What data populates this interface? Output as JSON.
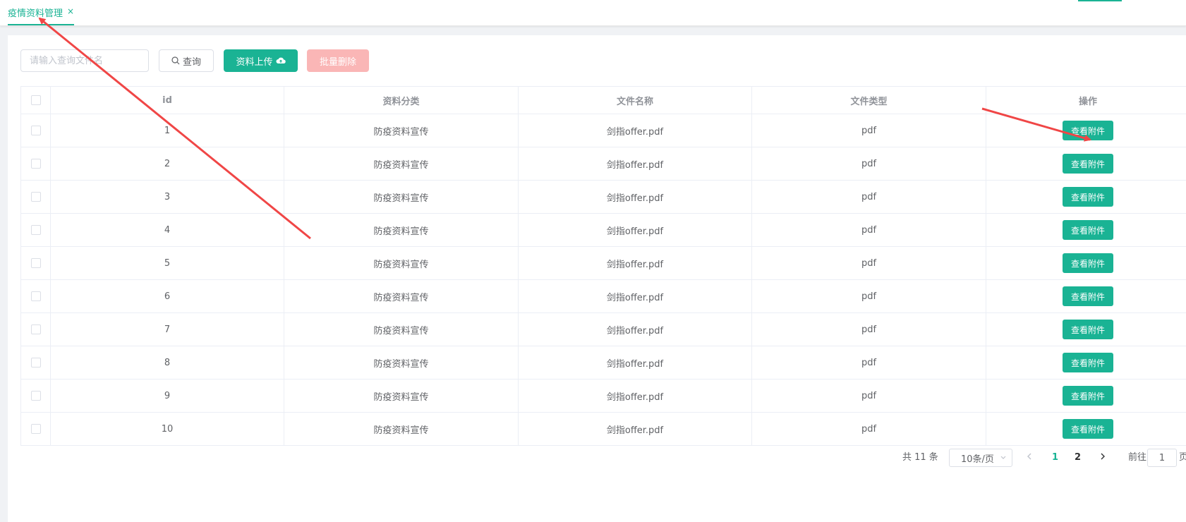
{
  "tabs": [
    {
      "label": "疫情资料管理",
      "close": "×"
    }
  ],
  "toolbar": {
    "search_placeholder": "请输入查询文件名",
    "search_button": "查询",
    "upload_button": "资料上传",
    "delete_button": "批量删除"
  },
  "table": {
    "columns": [
      "id",
      "资料分类",
      "文件名称",
      "文件类型",
      "操作"
    ],
    "rows": [
      {
        "id": "1",
        "category": "防疫资料宣传",
        "filename": "剑指offer.pdf",
        "type": "pdf",
        "action": "查看附件"
      },
      {
        "id": "2",
        "category": "防疫资料宣传",
        "filename": "剑指offer.pdf",
        "type": "pdf",
        "action": "查看附件"
      },
      {
        "id": "3",
        "category": "防疫资料宣传",
        "filename": "剑指offer.pdf",
        "type": "pdf",
        "action": "查看附件"
      },
      {
        "id": "4",
        "category": "防疫资料宣传",
        "filename": "剑指offer.pdf",
        "type": "pdf",
        "action": "查看附件"
      },
      {
        "id": "5",
        "category": "防疫资料宣传",
        "filename": "剑指offer.pdf",
        "type": "pdf",
        "action": "查看附件"
      },
      {
        "id": "6",
        "category": "防疫资料宣传",
        "filename": "剑指offer.pdf",
        "type": "pdf",
        "action": "查看附件"
      },
      {
        "id": "7",
        "category": "防疫资料宣传",
        "filename": "剑指offer.pdf",
        "type": "pdf",
        "action": "查看附件"
      },
      {
        "id": "8",
        "category": "防疫资料宣传",
        "filename": "剑指offer.pdf",
        "type": "pdf",
        "action": "查看附件"
      },
      {
        "id": "9",
        "category": "防疫资料宣传",
        "filename": "剑指offer.pdf",
        "type": "pdf",
        "action": "查看附件"
      },
      {
        "id": "10",
        "category": "防疫资料宣传",
        "filename": "剑指offer.pdf",
        "type": "pdf",
        "action": "查看附件"
      }
    ]
  },
  "pagination": {
    "total": "共 11 条",
    "page_size": "10条/页",
    "pages": [
      "1",
      "2"
    ],
    "goto_label": "前往",
    "goto_value": "1",
    "page_suffix": "页"
  },
  "colors": {
    "accent": "#1ab394",
    "danger_disabled": "#fab6b6",
    "annotation": "#f04646"
  },
  "icons": [
    "close-icon",
    "search-icon",
    "cloud-upload-icon",
    "chevron-down-icon",
    "chevron-left-icon",
    "chevron-right-icon"
  ]
}
